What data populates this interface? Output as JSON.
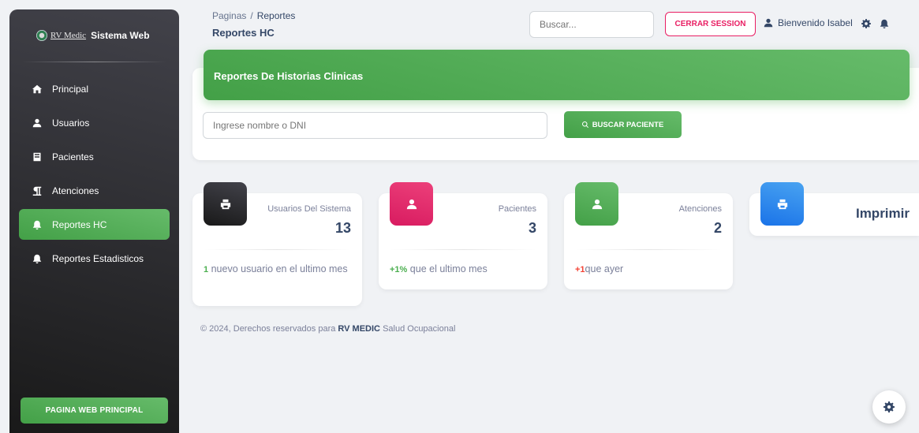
{
  "sidebar": {
    "brand_logo_text": "RV Medic",
    "brand_title": "Sistema Web",
    "items": [
      {
        "label": "Principal",
        "icon": "home-icon",
        "active": false
      },
      {
        "label": "Usuarios",
        "icon": "user-icon",
        "active": false
      },
      {
        "label": "Pacientes",
        "icon": "book-icon",
        "active": false
      },
      {
        "label": "Atenciones",
        "icon": "paragraph-icon",
        "active": false
      },
      {
        "label": "Reportes HC",
        "icon": "bell-icon",
        "active": true
      },
      {
        "label": "Reportes Estadisticos",
        "icon": "bell-icon",
        "active": false
      }
    ],
    "cta_label": "PAGINA WEB PRINCIPAL"
  },
  "header": {
    "breadcrumb_root": "Paginas",
    "breadcrumb_sep": "/",
    "breadcrumb_current": "Reportes",
    "page_title": "Reportes HC",
    "search_placeholder": "Buscar...",
    "logout_label": "CERRAR SESSION",
    "welcome": "Bienvenido Isabel"
  },
  "report_panel": {
    "title": "Reportes De Historias Clinicas",
    "dni_placeholder": "Ingrese nombre o DNI",
    "search_button": "BUSCAR PACIENTE"
  },
  "stats": [
    {
      "label": "Usuarios Del Sistema",
      "value": "13",
      "foot_strong": "1",
      "foot_text": " nuevo usuario en el ultimo mes",
      "icon": "print-icon",
      "color": "#1f1f1f"
    },
    {
      "label": "Pacientes",
      "value": "3",
      "foot_strong": "+1%",
      "foot_text": " que el ultimo mes",
      "icon": "user-icon",
      "color": "#e91e63"
    },
    {
      "label": "Atenciones",
      "value": "2",
      "foot_strong": "+1",
      "foot_text": "que ayer",
      "icon": "user-icon",
      "color": "#4caf50"
    }
  ],
  "print_card": {
    "label": "Imprimir",
    "icon": "print-icon",
    "color": "#1a73e8"
  },
  "footer": {
    "prefix": "© 2024, Derechos reservados para ",
    "brand": "RV MEDIC",
    "suffix": " Salud Ocupacional"
  },
  "colors": {
    "accent_green": "#4caf50",
    "accent_pink": "#e91e63",
    "accent_blue": "#1a73e8",
    "dark": "#1f1f1f"
  }
}
